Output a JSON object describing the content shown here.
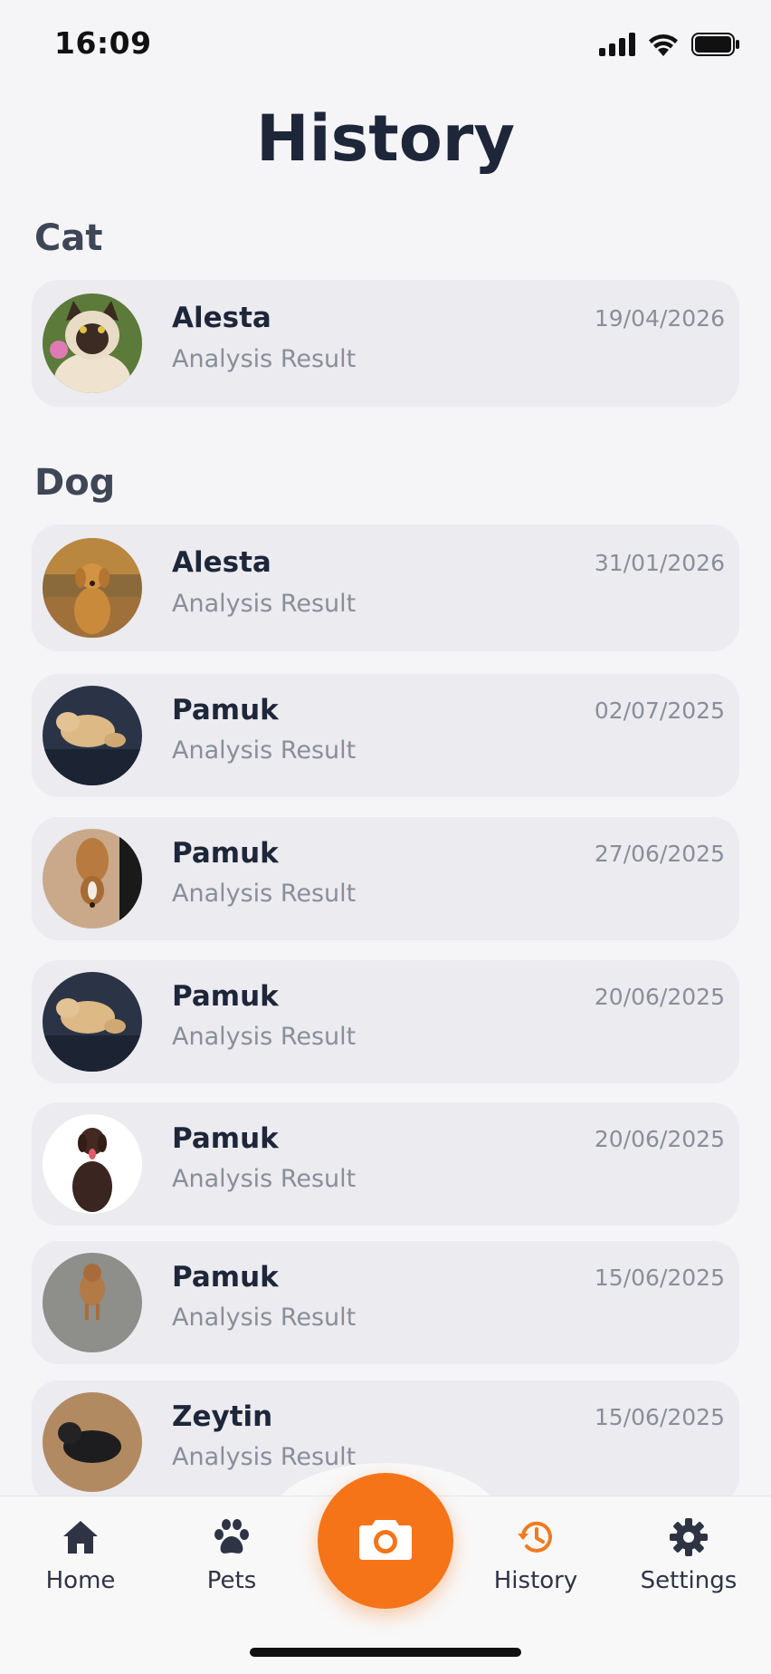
{
  "status_bar": {
    "time": "16:09"
  },
  "page": {
    "title": "History"
  },
  "sections": [
    {
      "title": "Cat",
      "items": [
        {
          "name": "Alesta",
          "subtitle": "Analysis Result",
          "date": "19/04/2026",
          "avatar": "cat-photo"
        }
      ]
    },
    {
      "title": "Dog",
      "items": [
        {
          "name": "Alesta",
          "subtitle": "Analysis Result",
          "date": "31/01/2026",
          "avatar": "golden-dog-photo"
        },
        {
          "name": "Pamuk",
          "subtitle": "Analysis Result",
          "date": "02/07/2025",
          "avatar": "dog-on-sofa-photo"
        },
        {
          "name": "Pamuk",
          "subtitle": "Analysis Result",
          "date": "27/06/2025",
          "avatar": "dog-on-tiles-photo"
        },
        {
          "name": "Pamuk",
          "subtitle": "Analysis Result",
          "date": "20/06/2025",
          "avatar": "dog-on-sofa-photo"
        },
        {
          "name": "Pamuk",
          "subtitle": "Analysis Result",
          "date": "20/06/2025",
          "avatar": "brown-labrador-photo"
        },
        {
          "name": "Pamuk",
          "subtitle": "Analysis Result",
          "date": "15/06/2025",
          "avatar": "dog-on-pavement-photo"
        },
        {
          "name": "Zeytin",
          "subtitle": "Analysis Result",
          "date": "15/06/2025",
          "avatar": "black-dog-photo"
        }
      ]
    }
  ],
  "bottom_nav": {
    "items": [
      {
        "label": "Home",
        "icon": "home-icon",
        "active": false
      },
      {
        "label": "Pets",
        "icon": "paw-icon",
        "active": false
      },
      {
        "label": "History",
        "icon": "history-icon",
        "active": true
      },
      {
        "label": "Settings",
        "icon": "gear-icon",
        "active": false
      }
    ],
    "center_button_icon": "camera-icon"
  },
  "colors": {
    "accent": "#f57418",
    "active_label": "#f07a1f",
    "card_bg": "#ebebf0",
    "page_bg": "#f5f5f8",
    "title_text": "#1e2639",
    "muted_text": "#8a8e99"
  }
}
